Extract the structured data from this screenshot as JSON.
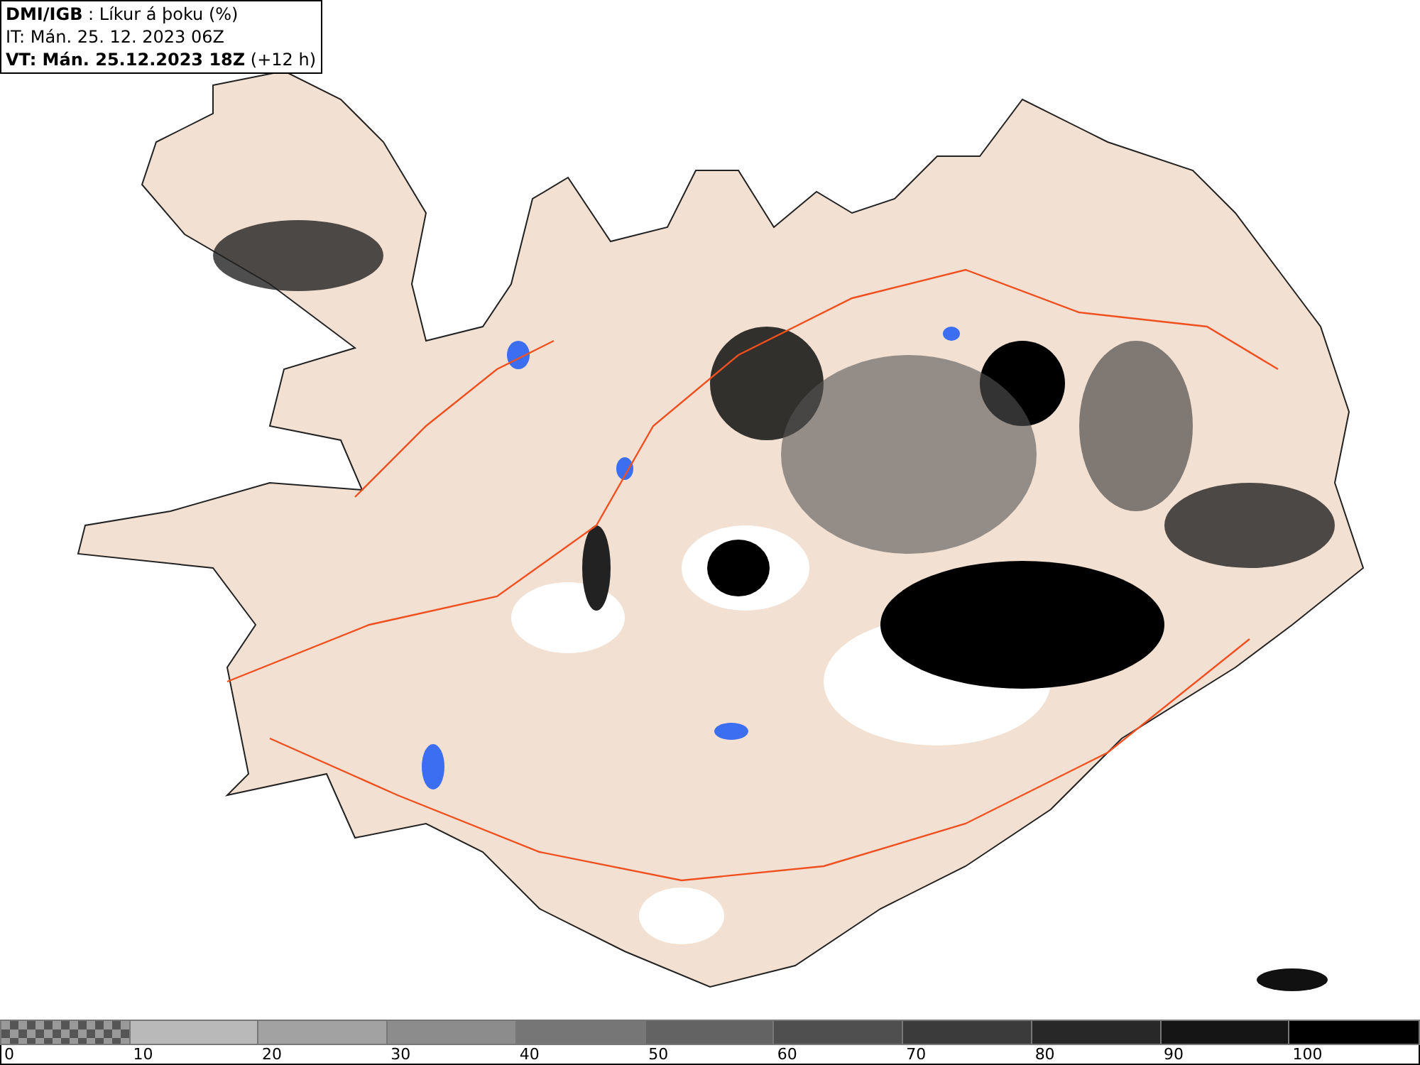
{
  "info": {
    "lines": [
      "**DMI/IGB** : Líkur á þoku (%)",
      "IT: Mán. 25. 12. 2023 06Z",
      "**VT: Mán. 25.12.2023 18Z** (+12 h)"
    ]
  },
  "legend": {
    "segments": [
      {
        "kind": "checker"
      },
      {
        "kind": "fill",
        "color": "#b9b9b9"
      },
      {
        "kind": "fill",
        "color": "#a2a2a2"
      },
      {
        "kind": "fill",
        "color": "#8c8c8c"
      },
      {
        "kind": "fill",
        "color": "#767676"
      },
      {
        "kind": "fill",
        "color": "#636363"
      },
      {
        "kind": "fill",
        "color": "#4f4f4f"
      },
      {
        "kind": "fill",
        "color": "#3b3b3b"
      },
      {
        "kind": "fill",
        "color": "#282828"
      },
      {
        "kind": "fill",
        "color": "#151515"
      },
      {
        "kind": "fill",
        "color": "#000000"
      }
    ],
    "labels": [
      "0",
      "10",
      "20",
      "30",
      "40",
      "50",
      "60",
      "70",
      "80",
      "90",
      "100"
    ]
  }
}
